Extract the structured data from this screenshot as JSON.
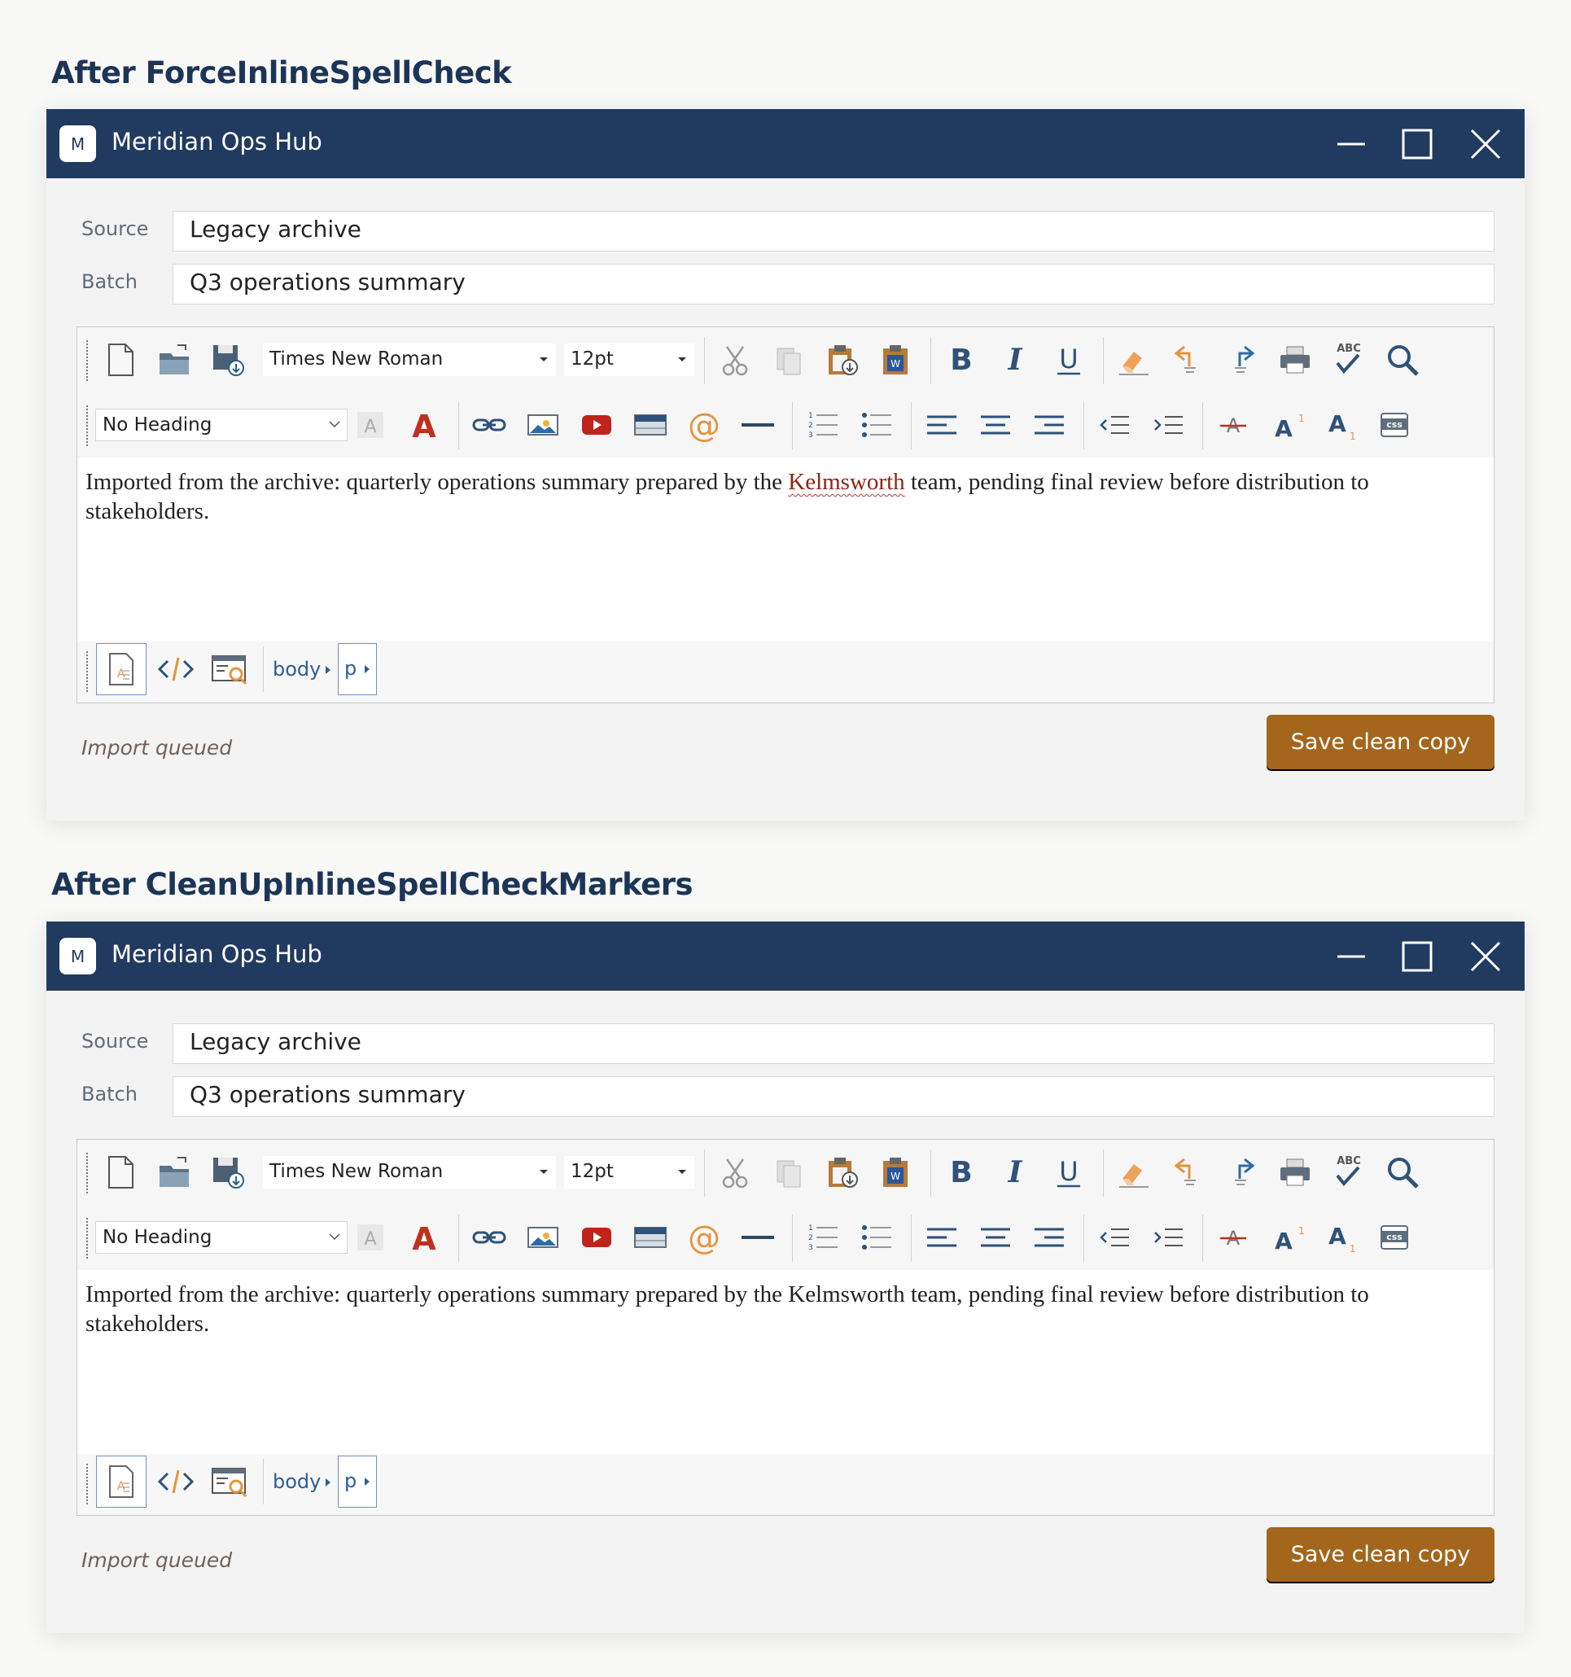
{
  "sections": [
    {
      "heading": "After ForceInlineSpellCheck",
      "window": {
        "logo_letter": "M",
        "title": "Meridian Ops Hub",
        "form": {
          "source_label": "Source",
          "source_value": "Legacy archive",
          "batch_label": "Batch",
          "batch_value": "Q3 operations summary"
        },
        "toolbar": {
          "font_family": "Times New Roman",
          "font_size": "12pt",
          "paragraph_format": "No Heading",
          "spell_check_label": "ABC",
          "css_label": "css"
        },
        "content": {
          "text_before": "Imported from the archive: quarterly operations summary prepared by the ",
          "flagged_word": "Kelmsworth",
          "text_after": " team, pending final review before distribution to stakeholders."
        },
        "breadcrumb": [
          "body",
          "p"
        ],
        "status": "Import queued",
        "save_label": "Save clean copy"
      }
    },
    {
      "heading": "After CleanUpInlineSpellCheckMarkers",
      "window": {
        "logo_letter": "M",
        "title": "Meridian Ops Hub",
        "form": {
          "source_label": "Source",
          "source_value": "Legacy archive",
          "batch_label": "Batch",
          "batch_value": "Q3 operations summary"
        },
        "toolbar": {
          "font_family": "Times New Roman",
          "font_size": "12pt",
          "paragraph_format": "No Heading",
          "spell_check_label": "ABC",
          "css_label": "css"
        },
        "content": {
          "text": "Imported from the archive: quarterly operations summary prepared by the Kelmsworth team, pending final review before distribution to stakeholders."
        },
        "breadcrumb": [
          "body",
          "p"
        ],
        "status": "Import queued",
        "save_label": "Save clean copy"
      }
    }
  ],
  "colors": {
    "titlebar": "#213a60",
    "accent_button": "#a3661c",
    "heading": "#1c3557",
    "misspelled": "#8f2414"
  }
}
